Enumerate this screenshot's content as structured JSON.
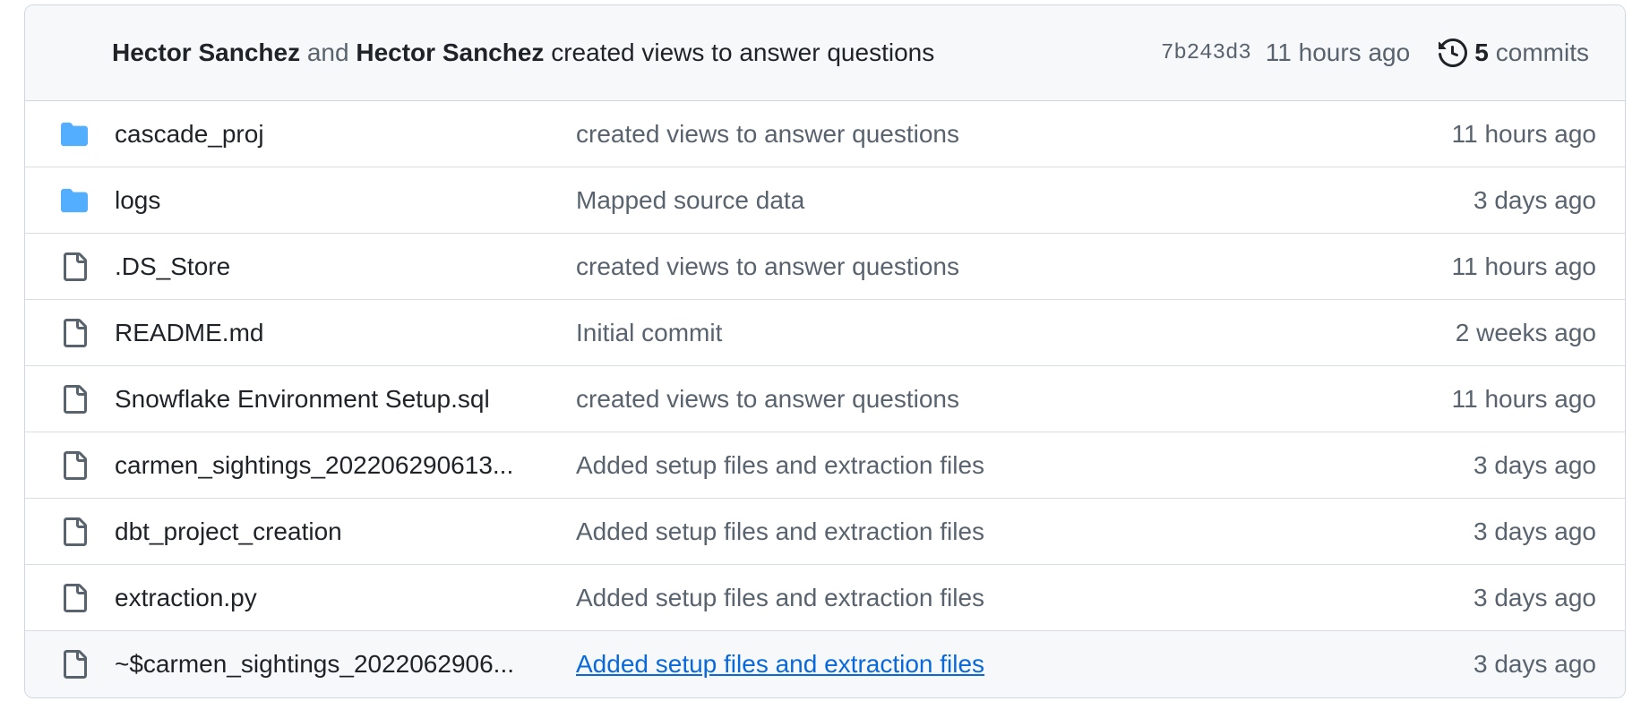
{
  "latest_commit": {
    "author1": "Hector Sanchez",
    "and_text": "and",
    "author2": "Hector Sanchez",
    "message": "created views to answer questions",
    "sha": "7b243d3",
    "when": "11 hours ago",
    "commit_count": "5",
    "commit_label": "commits"
  },
  "colors": {
    "folder": "#54aeff",
    "link": "#0969da",
    "muted": "#59636e",
    "border": "#d0d7de"
  },
  "files": [
    {
      "type": "folder",
      "icon": "folder-icon",
      "name": "cascade_proj",
      "message": "created views to answer questions",
      "age": "11 hours ago"
    },
    {
      "type": "folder",
      "icon": "folder-icon",
      "name": "logs",
      "message": "Mapped source data",
      "age": "3 days ago"
    },
    {
      "type": "file",
      "icon": "file-icon",
      "name": ".DS_Store",
      "message": "created views to answer questions",
      "age": "11 hours ago"
    },
    {
      "type": "file",
      "icon": "file-icon",
      "name": "README.md",
      "message": "Initial commit",
      "age": "2 weeks ago"
    },
    {
      "type": "file",
      "icon": "file-icon",
      "name": "Snowflake Environment Setup.sql",
      "message": "created views to answer questions",
      "age": "11 hours ago"
    },
    {
      "type": "file",
      "icon": "file-icon",
      "name": "carmen_sightings_202206290613...",
      "message": "Added setup files and extraction files",
      "age": "3 days ago"
    },
    {
      "type": "file",
      "icon": "file-icon",
      "name": "dbt_project_creation",
      "message": "Added setup files and extraction files",
      "age": "3 days ago"
    },
    {
      "type": "file",
      "icon": "file-icon",
      "name": "extraction.py",
      "message": "Added setup files and extraction files",
      "age": "3 days ago"
    },
    {
      "type": "file",
      "icon": "file-icon",
      "name": "~$carmen_sightings_2022062906...",
      "message": "Added setup files and extraction files",
      "age": "3 days ago",
      "hover": true
    }
  ]
}
